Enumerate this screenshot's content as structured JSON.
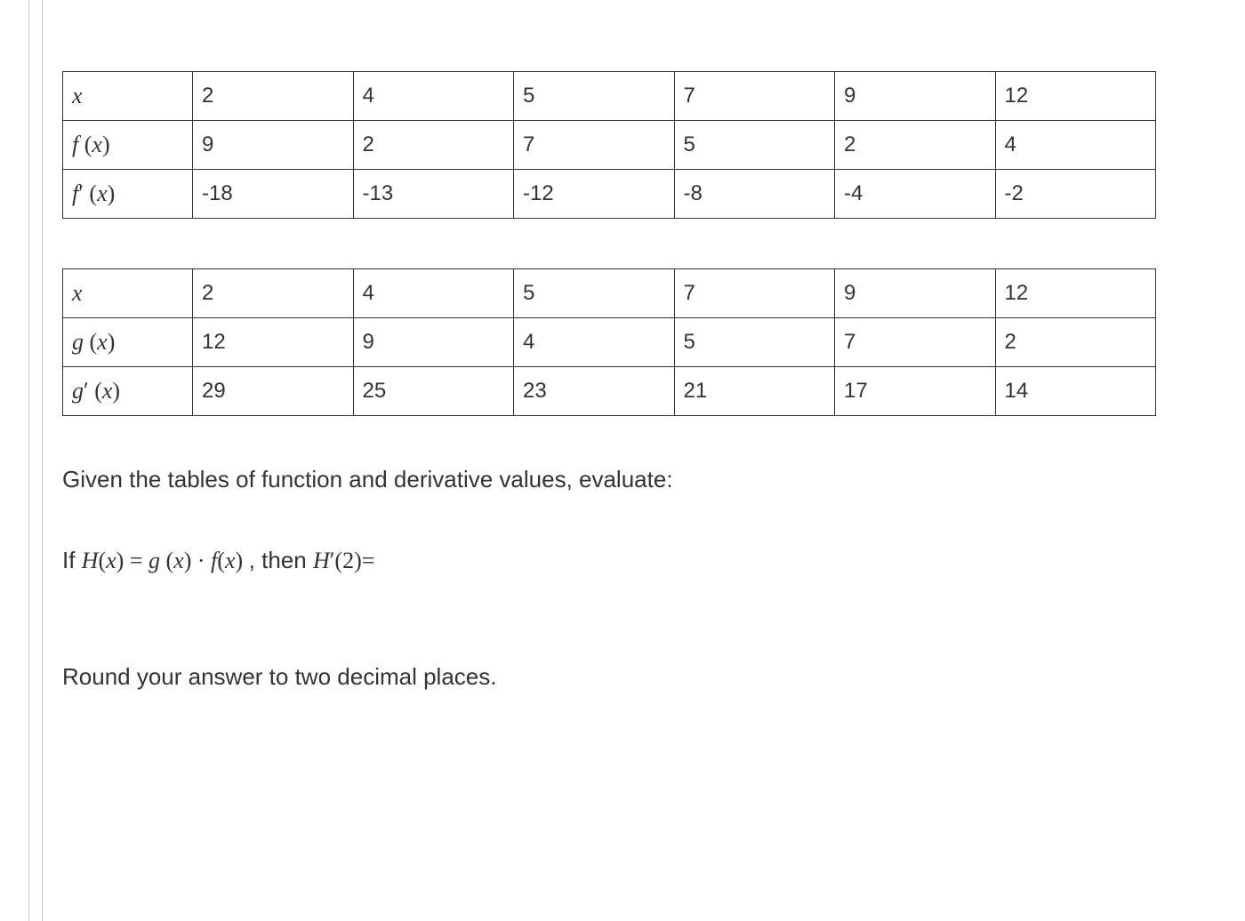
{
  "table_f": {
    "row_labels": [
      "x",
      "f (x)",
      "f′(x)"
    ],
    "cols": [
      "2",
      "4",
      "5",
      "7",
      "9",
      "12"
    ],
    "rows": [
      [
        "2",
        "4",
        "5",
        "7",
        "9",
        "12"
      ],
      [
        "9",
        "2",
        "7",
        "5",
        "2",
        "4"
      ],
      [
        "-18",
        "-13",
        "-12",
        "-8",
        "-4",
        "-2"
      ]
    ]
  },
  "table_g": {
    "row_labels": [
      "x",
      "g (x)",
      "g′(x)"
    ],
    "cols": [
      "2",
      "4",
      "5",
      "7",
      "9",
      "12"
    ],
    "rows": [
      [
        "2",
        "4",
        "5",
        "7",
        "9",
        "12"
      ],
      [
        "12",
        "9",
        "4",
        "5",
        "7",
        "2"
      ],
      [
        "29",
        "25",
        "23",
        "21",
        "17",
        "14"
      ]
    ]
  },
  "prompt": "Given the tables of function and derivative values, evaluate:",
  "question_prefix": "If ",
  "question_Hx": "H(x) = g (x) · f(x)",
  "question_mid": "  , then ",
  "question_Hprime": "H′(2)=",
  "round_note": "Round your answer to two decimal places.",
  "chart_data": [
    {
      "type": "table",
      "title": "f table",
      "columns": [
        "x",
        "f(x)",
        "f'(x)"
      ],
      "x": [
        2,
        4,
        5,
        7,
        9,
        12
      ],
      "f": [
        9,
        2,
        7,
        5,
        2,
        4
      ],
      "fprime": [
        -18,
        -13,
        -12,
        -8,
        -4,
        -2
      ]
    },
    {
      "type": "table",
      "title": "g table",
      "columns": [
        "x",
        "g(x)",
        "g'(x)"
      ],
      "x": [
        2,
        4,
        5,
        7,
        9,
        12
      ],
      "g": [
        12,
        9,
        4,
        5,
        7,
        2
      ],
      "gprime": [
        29,
        25,
        23,
        21,
        17,
        14
      ]
    }
  ]
}
